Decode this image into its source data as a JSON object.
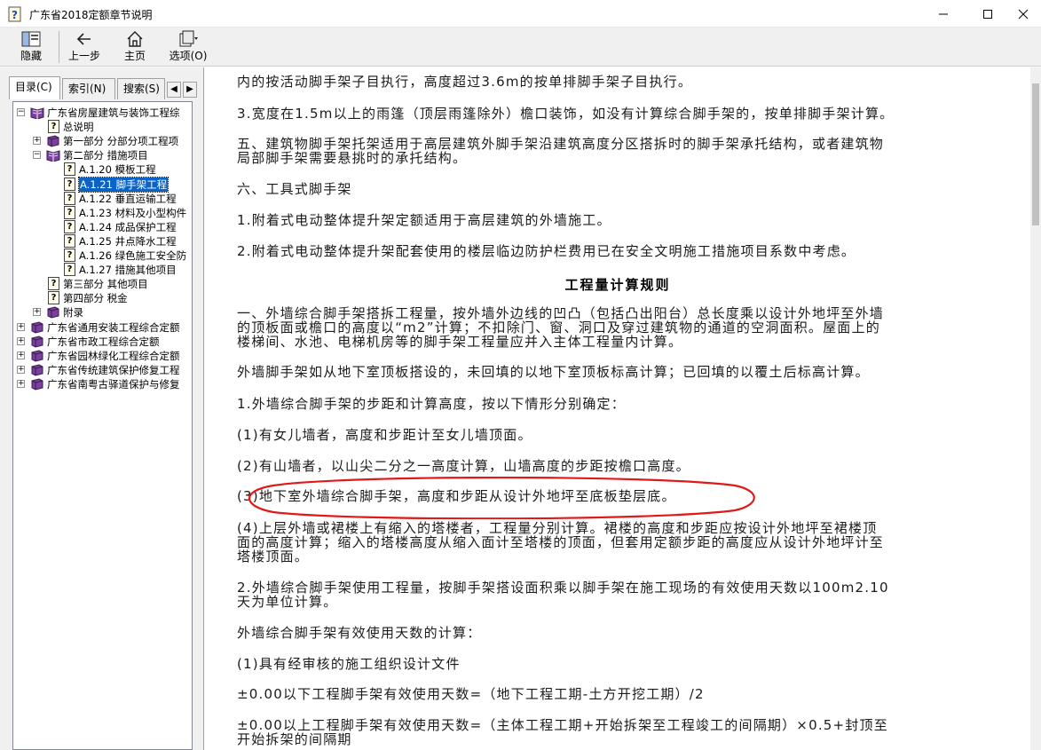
{
  "window": {
    "title": "广东省2018定额章节说明"
  },
  "toolbar": {
    "hide": "隐藏",
    "back": "上一步",
    "home": "主页",
    "options": "选项(O)"
  },
  "left_pane": {
    "tabs": [
      "目录(C)",
      "索引(N)",
      "搜索(S)"
    ],
    "tree": [
      {
        "label": "广东省房屋建筑与装饰工程综",
        "icon": "open-book-icon",
        "expander": "⊟"
      },
      {
        "label": "总说明",
        "icon": "help-page-icon"
      },
      {
        "label": "第一部分 分部分项工程项",
        "icon": "book-icon",
        "expander": "⊞"
      },
      {
        "label": "第二部分 措施项目",
        "icon": "open-book-icon",
        "expander": "⊟"
      },
      {
        "label": "A.1.20 模板工程",
        "icon": "help-page-icon"
      },
      {
        "label": "A.1.21 脚手架工程",
        "icon": "help-page-icon",
        "selected": true
      },
      {
        "label": "A.1.22 垂直运输工程",
        "icon": "help-page-icon"
      },
      {
        "label": "A.1.23 材料及小型构件",
        "icon": "help-page-icon"
      },
      {
        "label": "A.1.24 成品保护工程",
        "icon": "help-page-icon"
      },
      {
        "label": "A.1.25 井点降水工程",
        "icon": "help-page-icon"
      },
      {
        "label": "A.1.26 绿色施工安全防",
        "icon": "help-page-icon"
      },
      {
        "label": "A.1.27 措施其他项目",
        "icon": "help-page-icon"
      },
      {
        "label": "第三部分 其他项目",
        "icon": "help-page-icon"
      },
      {
        "label": "第四部分 税金",
        "icon": "help-page-icon"
      },
      {
        "label": "附录",
        "icon": "book-icon",
        "expander": "⊞"
      },
      {
        "label": "广东省通用安装工程综合定额",
        "icon": "book-icon",
        "expander": "⊞"
      },
      {
        "label": "广东省市政工程综合定额",
        "icon": "book-icon",
        "expander": "⊞"
      },
      {
        "label": "广东省园林绿化工程综合定额",
        "icon": "book-icon",
        "expander": "⊞"
      },
      {
        "label": "广东省传统建筑保护修复工程",
        "icon": "book-icon",
        "expander": "⊞"
      },
      {
        "label": "广东省南粤古驿道保护与修复",
        "icon": "book-icon",
        "expander": "⊞"
      }
    ]
  },
  "content": {
    "p1_line1": "内的按活动脚手架子目执行，高度超过3.6m的按单排脚手架子目执行。",
    "p2": "3.宽度在1.5m以上的雨篷（顶层雨篷除外）檐口装饰，如没有计算综合脚手架的，按单排脚手架计算。",
    "p3_l1": "五、建筑物脚手架托架适用于高层建筑外脚手架沿建筑高度分区搭拆时的脚手架承托结构，或者建筑物",
    "p3_l2": "局部脚手架需要悬挑时的承托结构。",
    "p4": "六、工具式脚手架",
    "p5": "1.附着式电动整体提升架定额适用于高层建筑的外墙施工。",
    "p6": "2.附着式电动整体提升架配套使用的楼层临边防护栏费用已在安全文明施工措施项目系数中考虑。",
    "heading": "工程量计算规则",
    "p7_l1": "一、外墙综合脚手架搭拆工程量，按外墙外边线的凹凸（包括凸出阳台）总长度乘以设计外地坪至外墙",
    "p7_l2": "的顶板面或檐口的高度以“m2”计算；不扣除门、窗、洞口及穿过建筑物的通道的空洞面积。屋面上的",
    "p7_l3": "楼梯间、水池、电梯机房等的脚手架工程量应并入主体工程量内计算。",
    "p8": "外墙脚手架如从地下室顶板搭设的，未回填的以地下室顶板标高计算；已回填的以覆土后标高计算。",
    "p9": "1.外墙综合脚手架的步距和计算高度，按以下情形分别确定：",
    "p10": "(1)有女儿墙者，高度和步距计至女儿墙顶面。",
    "p11": "(2)有山墙者，以山尖二分之一高度计算，山墙高度的步距按檐口高度。",
    "p12": "(3)地下室外墙综合脚手架，高度和步距从设计外地坪至底板垫层底。",
    "p13_l1": "(4)上层外墙或裙楼上有缩入的塔楼者，工程量分别计算。裙楼的高度和步距应按设计外地坪至裙楼顶",
    "p13_l2": "面的高度计算；缩入的塔楼高度从缩入面计至塔楼的顶面，但套用定额步距的高度应从设计外地坪计至",
    "p13_l3": "塔楼顶面。",
    "p14_l1": "2.外墙综合脚手架使用工程量，按脚手架搭设面积乘以脚手架在施工现场的有效使用天数以100m2.10",
    "p14_l2": "天为单位计算。",
    "p15": "外墙综合脚手架有效使用天数的计算：",
    "p16": "(1)具有经审核的施工组织设计文件",
    "p17": "±0.00以下工程脚手架有效使用天数=（地下工程工期-土方开挖工期）/2",
    "p18_l1": "±0.00以上工程脚手架有效使用天数=（主体工程工期+开始拆架至工程竣工的间隔期）×0.5+封顶至",
    "p18_l2": "开始拆架的间隔期"
  },
  "colors": {
    "selection": "#0a64c8",
    "ellipse": "#e0191b"
  }
}
